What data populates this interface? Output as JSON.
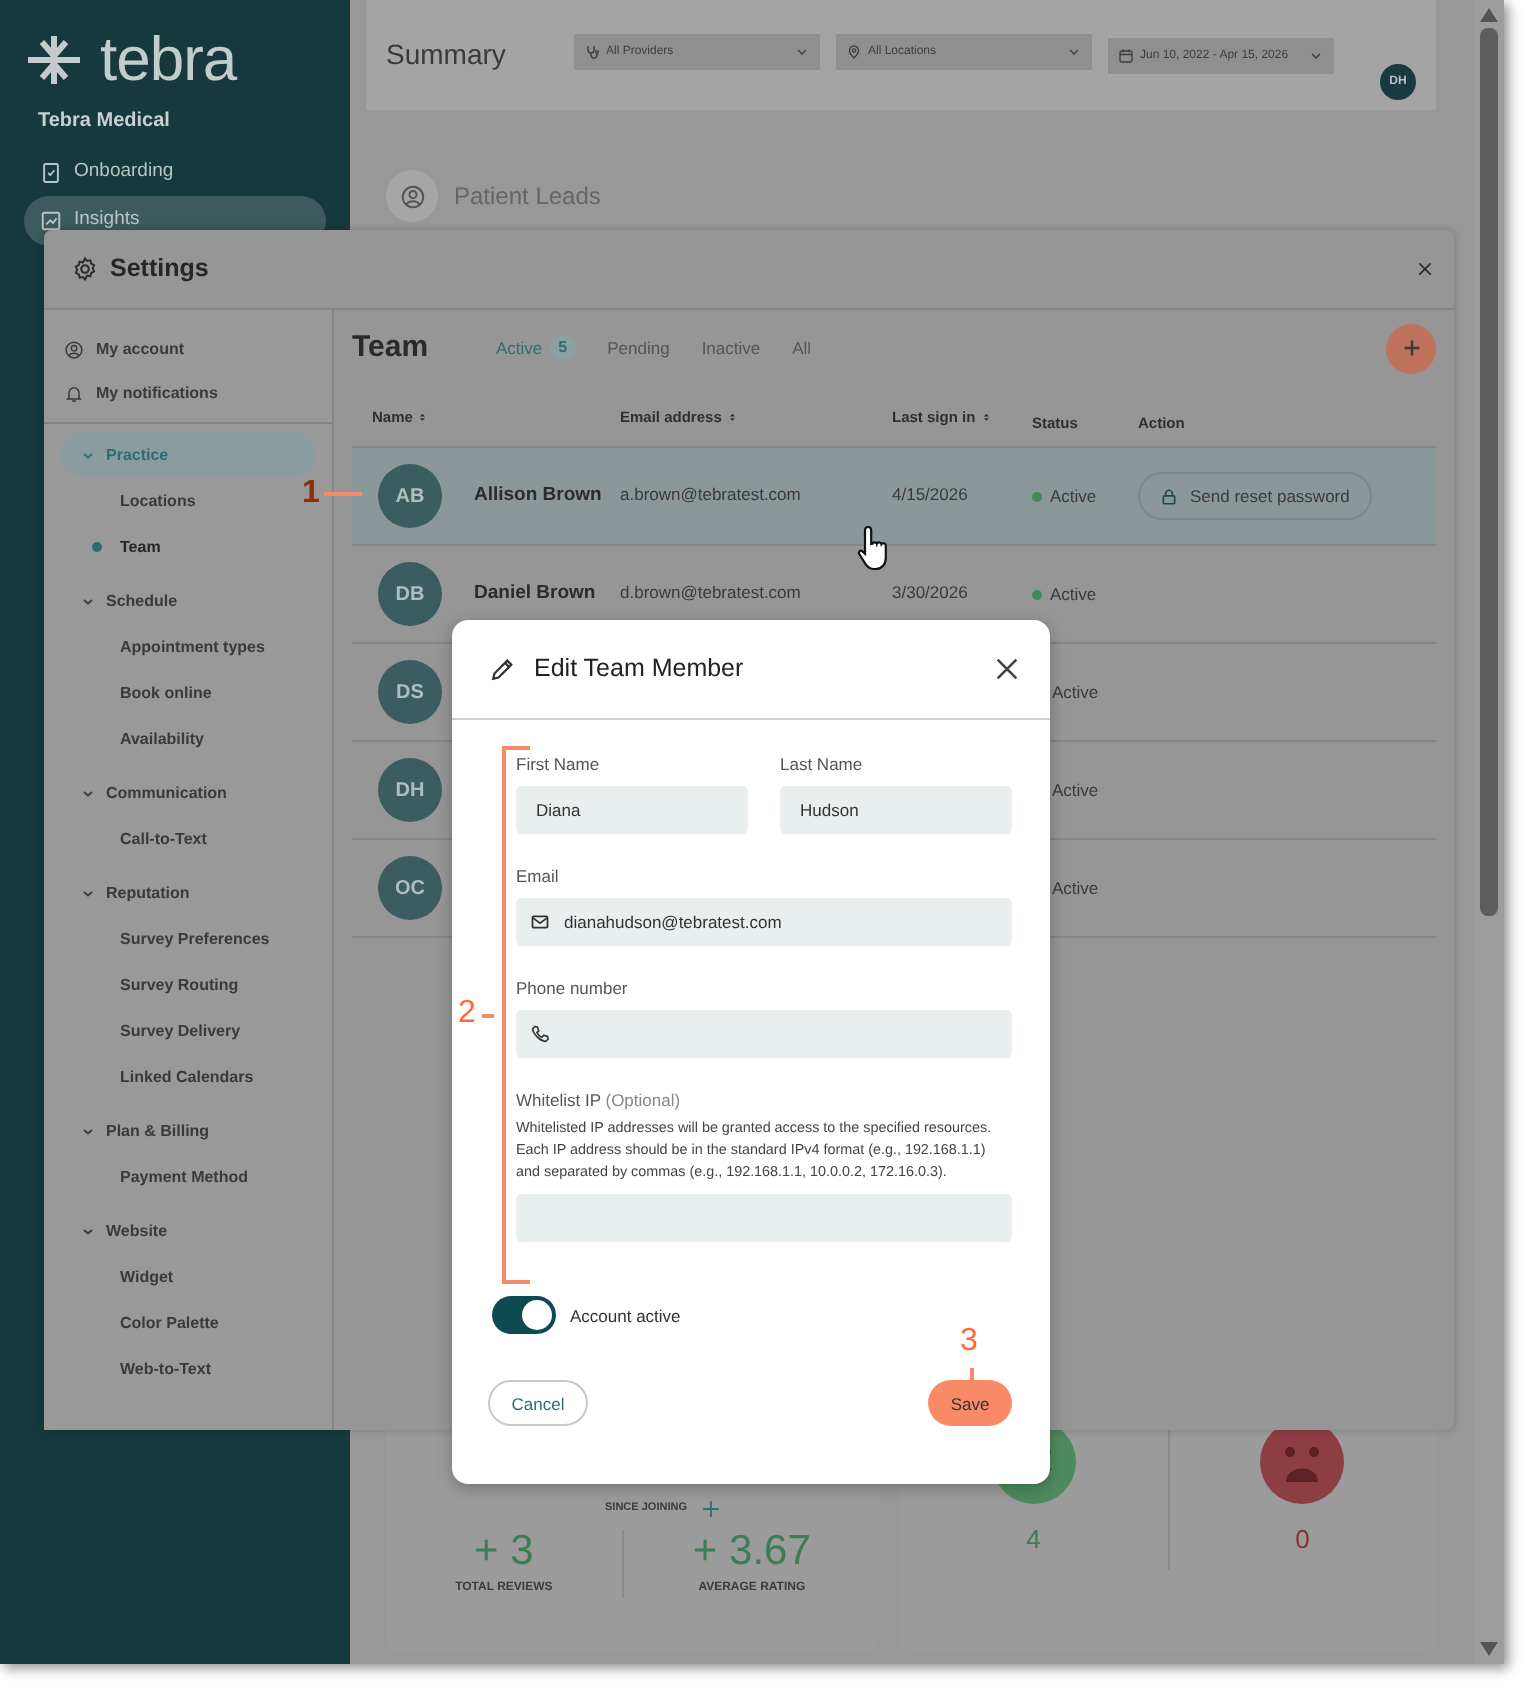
{
  "sidebar": {
    "logo": "tebra",
    "practice": "Tebra Medical",
    "items": [
      {
        "label": "Onboarding",
        "kind": "onboarding",
        "selected": false
      },
      {
        "label": "Insights",
        "kind": "insights",
        "selected": true
      }
    ]
  },
  "header": {
    "title": "Summary",
    "filters": [
      {
        "kind": "provider",
        "label": "All Providers"
      },
      {
        "kind": "location",
        "label": "All Locations"
      },
      {
        "kind": "date",
        "label": "Jun 10, 2022 - Apr 15, 2026"
      }
    ],
    "avatar": "DH"
  },
  "section": {
    "title": "Patient Leads"
  },
  "stats": {
    "since": "SINCE JOINING",
    "metrics": [
      {
        "value": "+ 3",
        "label": "TOTAL REVIEWS"
      },
      {
        "value": "+ 3.67",
        "label": "AVERAGE RATING"
      }
    ],
    "sentiment": [
      {
        "kind": "happy",
        "count": "4"
      },
      {
        "kind": "sad",
        "count": "0"
      }
    ]
  },
  "settings": {
    "title": "Settings",
    "nav": [
      {
        "kind": "account",
        "label": "My account"
      },
      {
        "kind": "notifications",
        "label": "My notifications"
      }
    ],
    "groups": [
      {
        "label": "Practice",
        "expanded": true,
        "selected": true,
        "children": [
          {
            "label": "Locations",
            "selected": false
          },
          {
            "label": "Team",
            "selected": true
          }
        ]
      },
      {
        "label": "Schedule",
        "expanded": true,
        "selected": false,
        "children": [
          {
            "label": "Appointment types",
            "selected": false
          },
          {
            "label": "Book online",
            "selected": false
          },
          {
            "label": "Availability",
            "selected": false
          }
        ]
      },
      {
        "label": "Communication",
        "expanded": true,
        "selected": false,
        "children": [
          {
            "label": "Call-to-Text",
            "selected": false
          }
        ]
      },
      {
        "label": "Reputation",
        "expanded": true,
        "selected": false,
        "children": [
          {
            "label": "Survey Preferences",
            "selected": false
          },
          {
            "label": "Survey Routing",
            "selected": false
          },
          {
            "label": "Survey Delivery",
            "selected": false
          },
          {
            "label": "Linked Calendars",
            "selected": false
          }
        ]
      },
      {
        "label": "Plan & Billing",
        "expanded": true,
        "selected": false,
        "children": [
          {
            "label": "Payment Method",
            "selected": false
          }
        ]
      },
      {
        "label": "Website",
        "expanded": true,
        "selected": false,
        "children": [
          {
            "label": "Widget",
            "selected": false
          },
          {
            "label": "Color Palette",
            "selected": false
          },
          {
            "label": "Web-to-Text",
            "selected": false
          }
        ]
      }
    ]
  },
  "team": {
    "title": "Team",
    "tabs": [
      {
        "label": "Active",
        "count": "5",
        "selected": true
      },
      {
        "label": "Pending",
        "selected": false
      },
      {
        "label": "Inactive",
        "selected": false
      },
      {
        "label": "All",
        "selected": false
      }
    ],
    "columns": [
      {
        "label": "Name",
        "sortable": true
      },
      {
        "label": "Email address",
        "sortable": true
      },
      {
        "label": "Last sign in",
        "sortable": true
      },
      {
        "label": "Status",
        "sortable": false
      },
      {
        "label": "Action",
        "sortable": false
      }
    ],
    "rows": [
      {
        "initials": "AB",
        "name": "Allison Brown",
        "email": "a.brown@tebratest.com",
        "last_sign_in": "4/15/2026",
        "status": "Active",
        "action": "Send reset password",
        "hovered": true
      },
      {
        "initials": "DB",
        "name": "Daniel Brown",
        "email": "d.brown@tebratest.com",
        "last_sign_in": "3/30/2026",
        "status": "Active",
        "hovered": false
      },
      {
        "initials": "DS",
        "status": "Active",
        "hovered": false
      },
      {
        "initials": "DH",
        "status": "Active",
        "hovered": false
      },
      {
        "initials": "OC",
        "status": "Active",
        "hovered": false
      }
    ]
  },
  "modal": {
    "title": "Edit Team Member",
    "fields": [
      {
        "kind": "text",
        "label": "First Name",
        "value": "Diana"
      },
      {
        "kind": "text",
        "label": "Last Name",
        "value": "Hudson"
      },
      {
        "kind": "email",
        "label": "Email",
        "value": "dianahudson@tebratest.com"
      },
      {
        "kind": "phone",
        "label": "Phone number"
      },
      {
        "kind": "ip",
        "label": "Whitelist IP",
        "hint": "(Optional)",
        "description": "Whitelisted IP addresses will be granted access to the specified resources. Each IP address should be in the standard IPv4 format (e.g., 192.168.1.1) and separated by commas (e.g., 192.168.1.1, 10.0.0.2, 172.16.0.3)."
      }
    ],
    "account_active": {
      "label": "Account active",
      "on": true
    },
    "buttons": [
      {
        "kind": "secondary",
        "label": "Cancel"
      },
      {
        "kind": "primary",
        "label": "Save"
      }
    ]
  },
  "annotations": [
    {
      "kind": "pointer-left",
      "label": "1"
    },
    {
      "kind": "bracket",
      "label": "2"
    },
    {
      "kind": "pointer-down",
      "label": "3"
    }
  ]
}
